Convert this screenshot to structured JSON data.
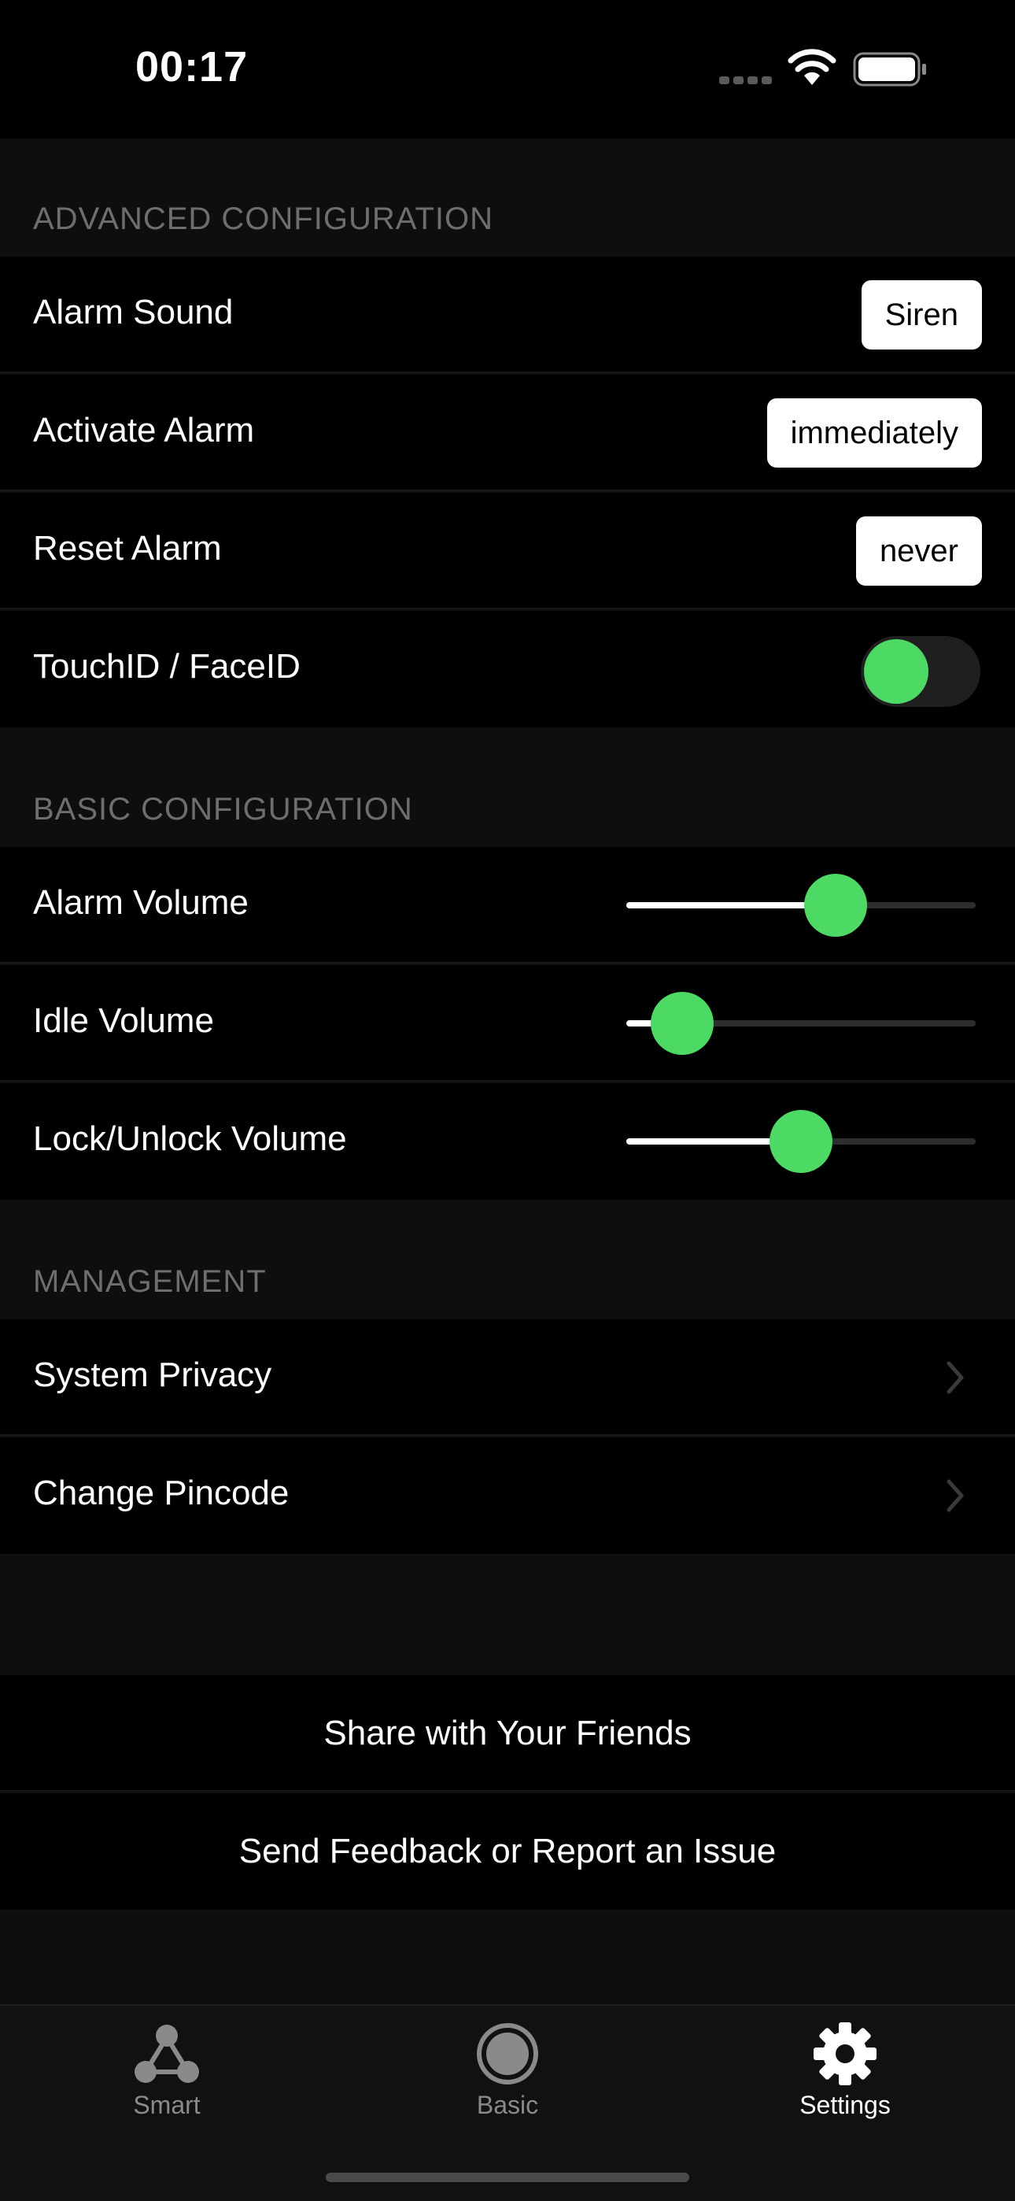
{
  "status_bar": {
    "time": "00:17",
    "icons": [
      "signal-icon",
      "wifi-icon",
      "battery-icon"
    ]
  },
  "advanced": {
    "header": "ADVANCED CONFIGURATION",
    "alarm_sound": {
      "label": "Alarm Sound",
      "value": "Siren"
    },
    "activate_alarm": {
      "label": "Activate Alarm",
      "value": "immediately"
    },
    "reset_alarm": {
      "label": "Reset Alarm",
      "value": "never"
    },
    "touch_face_id": {
      "label": "TouchID / FaceID",
      "enabled": false
    }
  },
  "basic": {
    "header": "BASIC CONFIGURATION",
    "alarm_volume": {
      "label": "Alarm Volume",
      "level": 0.6
    },
    "idle_volume": {
      "label": "Idle Volume",
      "level": 0.16
    },
    "lock_unlock_volume": {
      "label": "Lock/Unlock Volume",
      "level": 0.5
    }
  },
  "management": {
    "header": "MANAGEMENT",
    "system_privacy": "System Privacy",
    "change_pincode": "Change Pincode"
  },
  "actions": {
    "share": "Share with Your Friends",
    "feedback": "Send Feedback or Report an Issue"
  },
  "tabs": [
    {
      "label": "Smart",
      "icon": "smart-icon",
      "active": false
    },
    {
      "label": "Basic",
      "icon": "basic-icon",
      "active": false
    },
    {
      "label": "Settings",
      "icon": "gear-icon",
      "active": true
    }
  ],
  "colors": {
    "accent": "#4cd964",
    "background": "#0e0e0e",
    "row": "#000000",
    "header_text": "#6e6e6e"
  }
}
